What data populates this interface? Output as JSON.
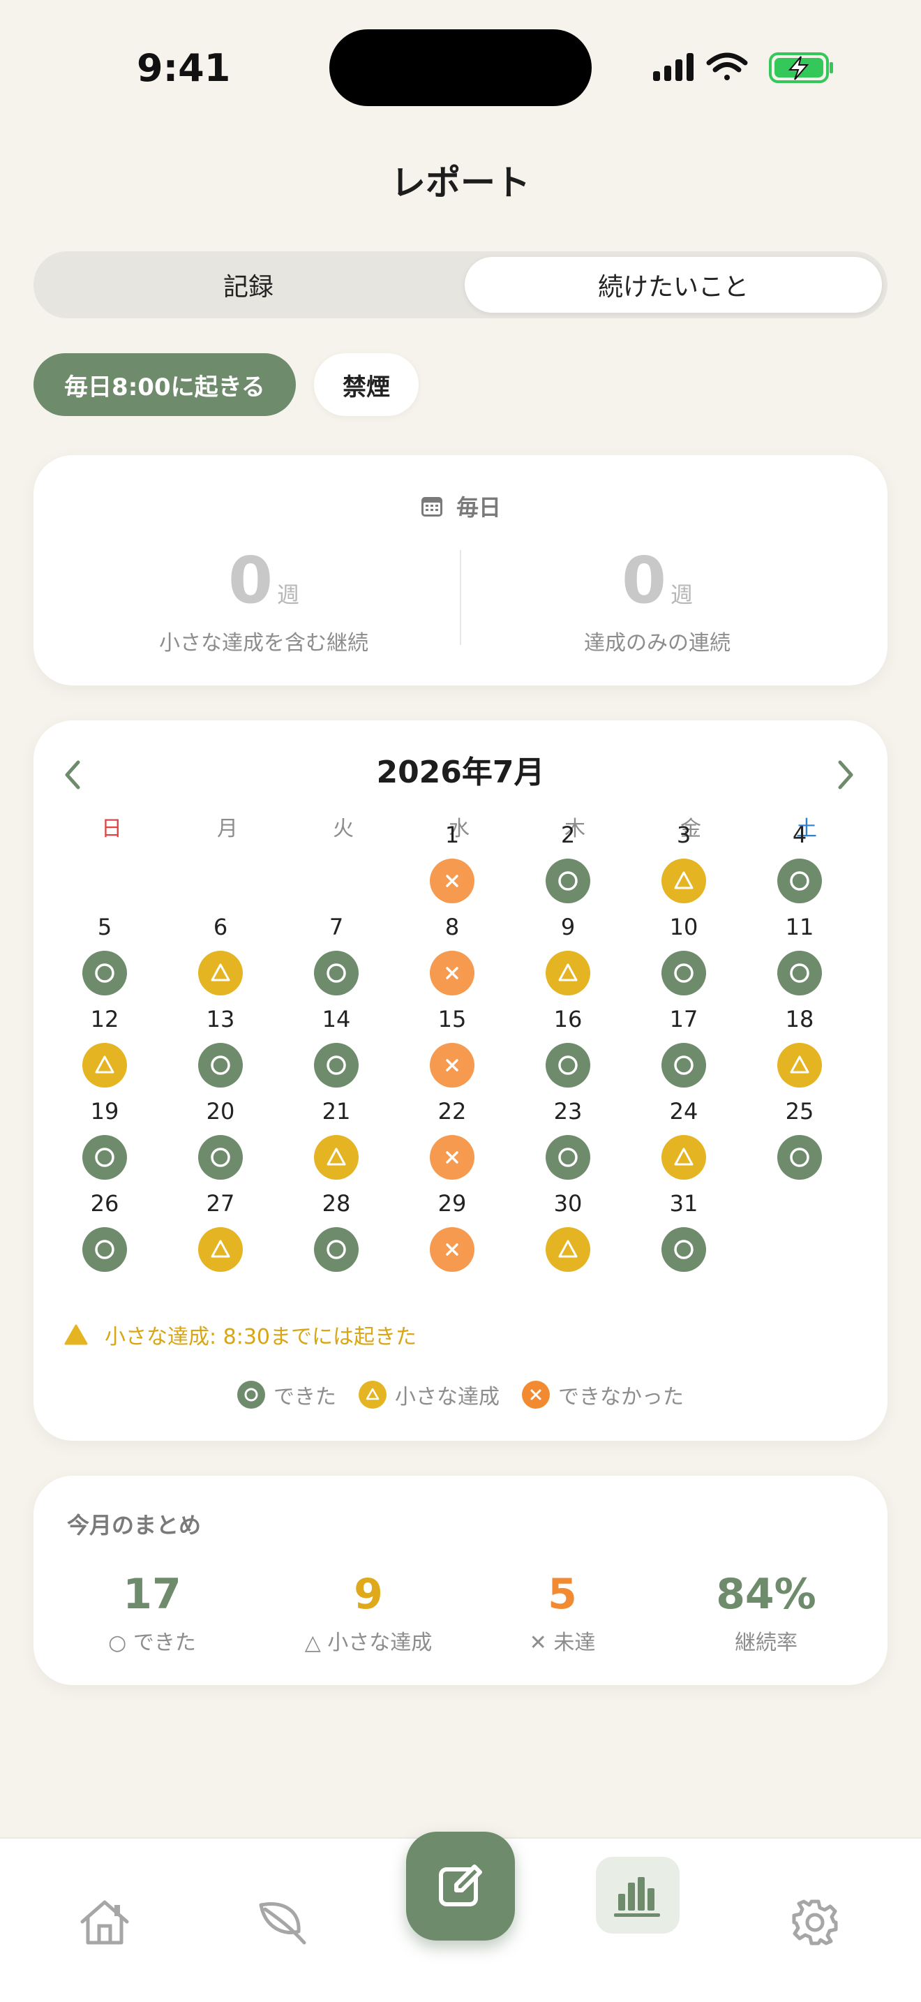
{
  "status_bar": {
    "time": "9:41"
  },
  "page_title": "レポート",
  "segmented": {
    "left_label": "記録",
    "right_label": "続けたいこと",
    "selected": "続けたいこと"
  },
  "habit_chips": [
    {
      "label": "毎日8:00に起きる",
      "active": true
    },
    {
      "label": "禁煙",
      "active": false
    }
  ],
  "streak": {
    "frequency_label": "毎日",
    "frequency_icon": "calendar-icon",
    "left": {
      "value": "0",
      "unit": "週",
      "label": "小さな達成を含む継続"
    },
    "right": {
      "value": "0",
      "unit": "週",
      "label": "達成のみの連続"
    }
  },
  "calendar": {
    "title": "2026年7月",
    "weekdays": [
      "日",
      "月",
      "火",
      "水",
      "木",
      "金",
      "土"
    ],
    "first_weekday_index": 3,
    "days": [
      {
        "d": "1",
        "s": "miss"
      },
      {
        "d": "2",
        "s": "done"
      },
      {
        "d": "3",
        "s": "small"
      },
      {
        "d": "4",
        "s": "done"
      },
      {
        "d": "5",
        "s": "done"
      },
      {
        "d": "6",
        "s": "small"
      },
      {
        "d": "7",
        "s": "done"
      },
      {
        "d": "8",
        "s": "miss"
      },
      {
        "d": "9",
        "s": "small"
      },
      {
        "d": "10",
        "s": "done"
      },
      {
        "d": "11",
        "s": "done"
      },
      {
        "d": "12",
        "s": "small"
      },
      {
        "d": "13",
        "s": "done"
      },
      {
        "d": "14",
        "s": "done"
      },
      {
        "d": "15",
        "s": "miss"
      },
      {
        "d": "16",
        "s": "done"
      },
      {
        "d": "17",
        "s": "done"
      },
      {
        "d": "18",
        "s": "small"
      },
      {
        "d": "19",
        "s": "done"
      },
      {
        "d": "20",
        "s": "done"
      },
      {
        "d": "21",
        "s": "small"
      },
      {
        "d": "22",
        "s": "miss"
      },
      {
        "d": "23",
        "s": "done"
      },
      {
        "d": "24",
        "s": "small"
      },
      {
        "d": "25",
        "s": "done"
      },
      {
        "d": "26",
        "s": "done"
      },
      {
        "d": "27",
        "s": "small"
      },
      {
        "d": "28",
        "s": "done"
      },
      {
        "d": "29",
        "s": "miss"
      },
      {
        "d": "30",
        "s": "small"
      },
      {
        "d": "31",
        "s": "done"
      }
    ],
    "small_goal_note": "小さな達成: 8:30までには起きた",
    "legend": [
      {
        "status": "done",
        "label": "できた"
      },
      {
        "status": "small",
        "label": "小さな達成"
      },
      {
        "status": "miss",
        "label": "できなかった"
      }
    ]
  },
  "summary": {
    "title": "今月のまとめ",
    "stats": [
      {
        "value": "17",
        "label": "○ できた",
        "color": "#6e8b6c"
      },
      {
        "value": "9",
        "label": "△ 小さな達成",
        "color": "#e0a91b"
      },
      {
        "value": "5",
        "label": "✕ 未達",
        "color": "#f28a32"
      },
      {
        "value": "84%",
        "label": "継続率",
        "color": "#6e8b6c"
      }
    ]
  },
  "colors": {
    "accent": "#6e8b6c",
    "small": "#e5b422",
    "miss": "#f59a4f",
    "background": "#f6f3ec"
  },
  "tab_bar": {
    "items": [
      "home-icon",
      "leaf-icon",
      "edit-icon",
      "bar-chart-icon",
      "gear-icon"
    ],
    "selected": "bar-chart-icon"
  }
}
